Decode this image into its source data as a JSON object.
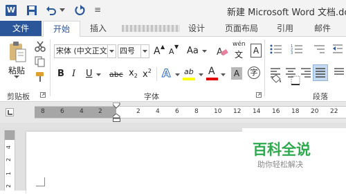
{
  "app": {
    "word_icon_letter": "W"
  },
  "title": {
    "text": "新建 Microsoft Word 文档.doc"
  },
  "quick_access": {
    "more": "≡"
  },
  "tabs": [
    {
      "label": "文件"
    },
    {
      "label": "开始"
    },
    {
      "label": "插入"
    },
    {
      "label": "设计"
    },
    {
      "label": "页面布局"
    },
    {
      "label": "引用"
    },
    {
      "label": "邮件"
    }
  ],
  "clipboard": {
    "paste_label": "粘贴",
    "group_label": "剪贴板"
  },
  "font": {
    "font_name": "宋体 (中文正文",
    "font_size": "四号",
    "grow_label": "A",
    "shrink_label": "A",
    "case_label": "Aa",
    "phonetic_top": "wén",
    "phonetic_bottom": "文",
    "border_char": "A",
    "bold": "B",
    "italic": "I",
    "underline": "U",
    "strike": "abc",
    "subscript": "x",
    "superscript": "x",
    "sub_mark": "2",
    "sup_mark": "2",
    "effects": "A",
    "highlight": "ab",
    "color": "A",
    "shading": "A",
    "enclose": "字",
    "group_label": "字体",
    "highlight_color": "#ffff00",
    "font_color": "#e00000"
  },
  "paragraph": {
    "group_label": "段落"
  },
  "ruler": {
    "numbers": [
      "8",
      "6",
      "4",
      "2",
      "2",
      "4",
      "6",
      "8",
      "10",
      "12",
      "14",
      "16",
      "18",
      "20",
      "22"
    ],
    "vertical": [
      "4",
      "2",
      "1",
      "2"
    ]
  },
  "watermark": {
    "main": "百科全说",
    "sub": "助你轻松解决",
    "color": "#2fa94e"
  }
}
